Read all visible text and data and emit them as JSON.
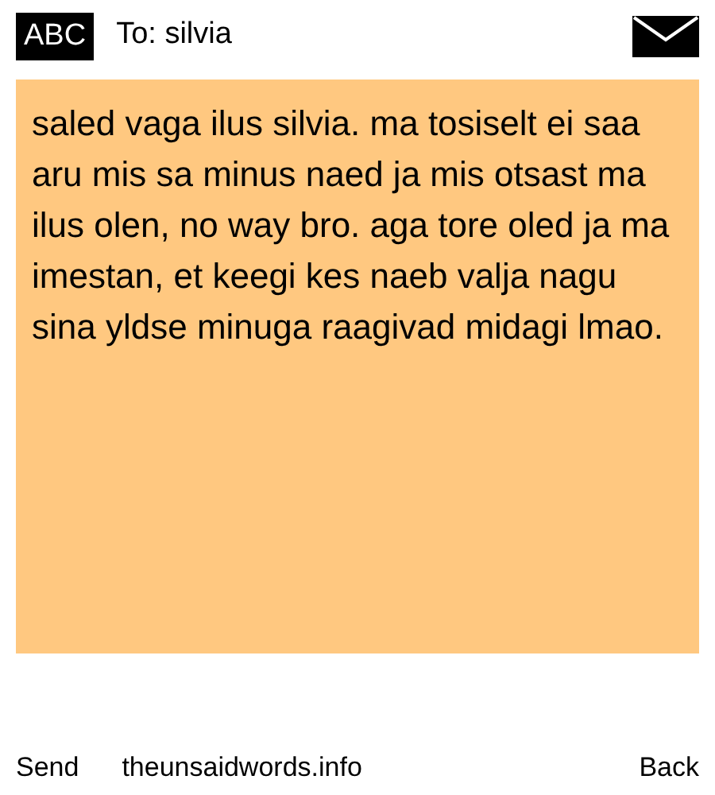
{
  "header": {
    "input_mode": "ABC",
    "recipient": "To: silvia"
  },
  "message": "saled vaga ilus silvia. ma tosiselt ei saa aru mis sa minus naed ja mis otsast ma ilus olen, no way bro. aga tore oled ja ma imestan, et keegi kes naeb valja nagu sina yldse minuga raagivad midagi lmao.",
  "softkeys": {
    "left": "Send",
    "center": "theunsaidwords.info",
    "right": "Back"
  }
}
